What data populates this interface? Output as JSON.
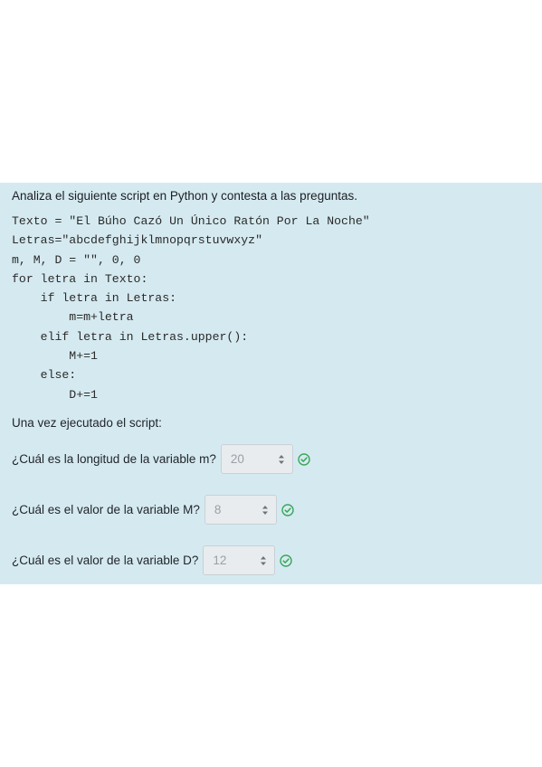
{
  "question": {
    "intro": "Analiza el siguiente script en Python y contesta a las preguntas.",
    "code_lines": [
      "Texto = \"El Búho Cazó Un Único Ratón Por La Noche\"",
      "Letras=\"abcdefghijklmnopqrstuvwxyz\"",
      "m, M, D = \"\", 0, 0",
      "for letra in Texto:",
      "    if letra in Letras:",
      "        m=m+letra",
      "    elif letra in Letras.upper():",
      "        M+=1",
      "    else:",
      "        D+=1"
    ],
    "after_text": "Una vez ejecutado el script:",
    "items": [
      {
        "label": "¿Cuál es la longitud de la variable m?",
        "selected": "20",
        "status": "correct"
      },
      {
        "label": "¿Cuál es el valor de la variable M?",
        "selected": "8",
        "status": "correct"
      },
      {
        "label": "¿Cuál es el valor de la variable D?",
        "selected": "12",
        "status": "correct"
      }
    ]
  },
  "colors": {
    "panel_background": "#d5eaf0",
    "check_green": "#3aa65a",
    "select_disabled_text": "#9aa0a6"
  },
  "icons": {
    "select_caret": "sort-caret-icon",
    "status": "check-circle-icon"
  }
}
